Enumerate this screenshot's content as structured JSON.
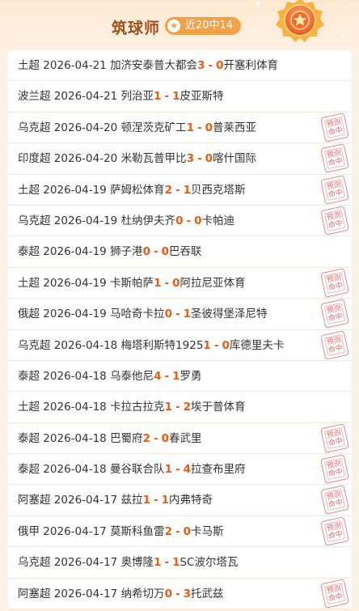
{
  "header": {
    "title": "筑球师",
    "badge": "近20中14"
  },
  "colors": {
    "accent": "#f05a0e",
    "title": "#a0501a",
    "badge_bg": "#f1a146",
    "stamp": "#e26c6d"
  },
  "stamp_text": [
    "预测",
    "命中"
  ],
  "matches": [
    {
      "league": "土超",
      "date": "2026-04-21",
      "home": "加济安泰普大都会",
      "home_score": "3",
      "away_score": "0",
      "away": "开塞利体育",
      "hit": false
    },
    {
      "league": "波兰超",
      "date": "2026-04-21",
      "home": "列治亚",
      "home_score": "1",
      "away_score": "1",
      "away": "皮亚斯特",
      "hit": false
    },
    {
      "league": "乌克超",
      "date": "2026-04-20",
      "home": "顿涅茨克矿工",
      "home_score": "1",
      "away_score": "0",
      "away": "普莱西亚",
      "hit": true
    },
    {
      "league": "印度超",
      "date": "2026-04-20",
      "home": "米勒瓦普甲比",
      "home_score": "3",
      "away_score": "0",
      "away": "喀什国际",
      "hit": true
    },
    {
      "league": "土超",
      "date": "2026-04-19",
      "home": "萨姆松体育",
      "home_score": "2",
      "away_score": "1",
      "away": "贝西克塔斯",
      "hit": true
    },
    {
      "league": "乌克超",
      "date": "2026-04-19",
      "home": "杜纳伊夫齐",
      "home_score": "0",
      "away_score": "0",
      "away": "卡帕迪",
      "hit": true
    },
    {
      "league": "泰超",
      "date": "2026-04-19",
      "home": "狮子港",
      "home_score": "0",
      "away_score": "0",
      "away": "巴吞联",
      "hit": false
    },
    {
      "league": "土超",
      "date": "2026-04-19",
      "home": "卡斯帕萨",
      "home_score": "1",
      "away_score": "0",
      "away": "阿拉尼亚体育",
      "hit": true
    },
    {
      "league": "俄超",
      "date": "2026-04-19",
      "home": "马哈奇卡拉",
      "home_score": "0",
      "away_score": "1",
      "away": "圣彼得堡泽尼特",
      "hit": true
    },
    {
      "league": "乌克超",
      "date": "2026-04-18",
      "home": "梅塔利斯特1925",
      "home_score": "1",
      "away_score": "0",
      "away": "库德里夫卡",
      "hit": true
    },
    {
      "league": "泰超",
      "date": "2026-04-18",
      "home": "乌泰他尼",
      "home_score": "4",
      "away_score": "1",
      "away": "罗勇",
      "hit": false
    },
    {
      "league": "土超",
      "date": "2026-04-18",
      "home": "卡拉古拉克",
      "home_score": "1",
      "away_score": "2",
      "away": "埃于普体育",
      "hit": false
    },
    {
      "league": "泰超",
      "date": "2026-04-18",
      "home": "巴蜀府",
      "home_score": "2",
      "away_score": "0",
      "away": "春武里",
      "hit": true
    },
    {
      "league": "泰超",
      "date": "2026-04-18",
      "home": "曼谷联合队",
      "home_score": "1",
      "away_score": "4",
      "away": "拉查布里府",
      "hit": true
    },
    {
      "league": "阿塞超",
      "date": "2026-04-17",
      "home": "兹拉",
      "home_score": "1",
      "away_score": "1",
      "away": "内弗特奇",
      "hit": true
    },
    {
      "league": "俄甲",
      "date": "2026-04-17",
      "home": "莫斯科鱼雷",
      "home_score": "2",
      "away_score": "0",
      "away": "卡马斯",
      "hit": true
    },
    {
      "league": "乌克超",
      "date": "2026-04-17",
      "home": "奥博隆",
      "home_score": "1",
      "away_score": "1",
      "away": "SC波尔塔瓦",
      "hit": false
    },
    {
      "league": "阿塞超",
      "date": "2026-04-17",
      "home": "纳希切万",
      "home_score": "0",
      "away_score": "3",
      "away": "托武兹",
      "hit": true
    }
  ]
}
